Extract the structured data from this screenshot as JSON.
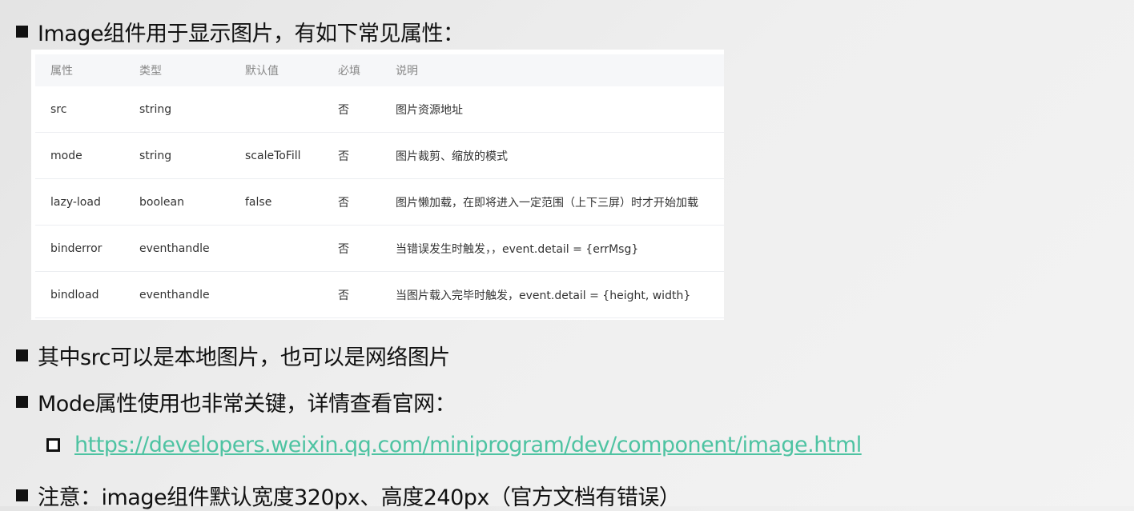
{
  "heading": "Image组件用于显示图片，有如下常见属性：",
  "table": {
    "headers": [
      "属性",
      "类型",
      "默认值",
      "必填",
      "说明"
    ],
    "rows": [
      [
        "src",
        "string",
        "",
        "否",
        "图片资源地址"
      ],
      [
        "mode",
        "string",
        "scaleToFill",
        "否",
        "图片裁剪、缩放的模式"
      ],
      [
        "lazy-load",
        "boolean",
        "false",
        "否",
        "图片懒加载，在即将进入一定范围（上下三屏）时才开始加载"
      ],
      [
        "binderror",
        "eventhandle",
        "",
        "否",
        "当错误发生时触发，，event.detail = {errMsg}"
      ],
      [
        "bindload",
        "eventhandle",
        "",
        "否",
        "当图片载入完毕时触发，event.detail = {height, width}"
      ]
    ]
  },
  "bullets": [
    "其中src可以是本地图片，也可以是网络图片",
    "Mode属性使用也非常关键，详情查看官网："
  ],
  "link": "https://developers.weixin.qq.com/miniprogram/dev/component/image.html",
  "note": "注意：image组件默认宽度320px、高度240px（官方文档有错误）",
  "colors": {
    "link": "#4ec3a2"
  }
}
